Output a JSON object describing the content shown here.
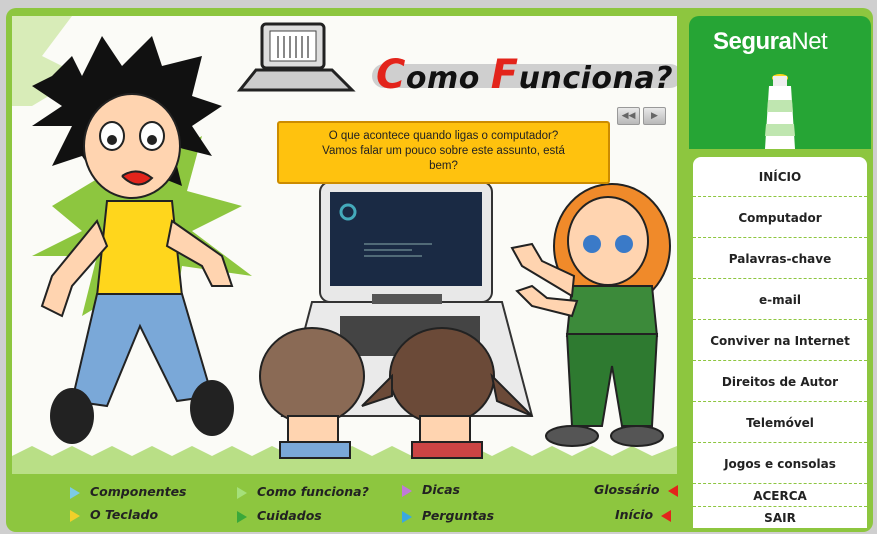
{
  "title": {
    "c1": "C",
    "rest1": "omo ",
    "c2": "F",
    "rest2": "unciona?"
  },
  "speech": {
    "line1": "O que acontece quando ligas o computador?",
    "line2": "Vamos falar um pouco sobre este assunto, está",
    "line3": "bem?"
  },
  "media": {
    "rewind_icon": "rewind-icon",
    "play_icon": "play-icon"
  },
  "bottom_nav": {
    "componentes": "Componentes",
    "como_funciona": "Como funciona?",
    "dicas": "Dicas",
    "glossario": "Glossário",
    "o_teclado": "O Teclado",
    "cuidados": "Cuidados",
    "perguntas": "Perguntas",
    "inicio": "Início"
  },
  "logo": {
    "segura": "Segura",
    "net": "Net"
  },
  "sidebar": {
    "items": [
      "INÍCIO",
      "Computador",
      "Palavras-chave",
      "e-mail",
      "Conviver na Internet",
      "Direitos de Autor",
      "Telemóvel",
      "Jogos e consolas",
      "ACERCA",
      "SAIR"
    ]
  },
  "colors": {
    "frame_green": "#8dc63f",
    "logo_green": "#26a535",
    "title_red": "#e3241b",
    "speech_yellow": "#ffc20e"
  }
}
